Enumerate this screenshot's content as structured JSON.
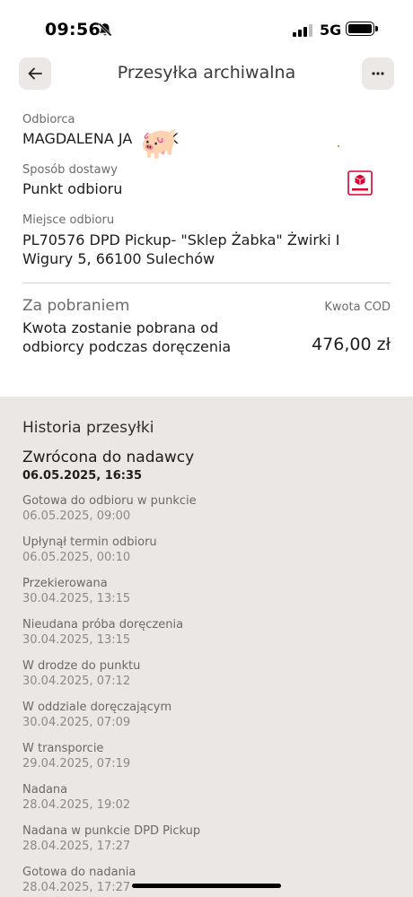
{
  "status_bar": {
    "time": "09:56",
    "network": "5G",
    "icons": [
      "bell-slash-icon",
      "signal-icon",
      "battery-icon"
    ]
  },
  "header": {
    "title": "Przesyłka archiwalna",
    "back_icon": "arrow-left-icon",
    "more_icon": "ellipsis-icon"
  },
  "recipient": {
    "label": "Odbiorca",
    "value": "MAGDALENA JA      EK"
  },
  "delivery": {
    "label": "Sposób dostawy",
    "value": "Punkt odbioru",
    "icon": "parcel-box-icon"
  },
  "pickup_place": {
    "label": "Miejsce odbioru",
    "value": "PL70576 DPD Pickup- \"Sklep Żabka\"  Żwirki I Wigury 5, 66100 Sulechów"
  },
  "cod": {
    "title": "Za pobraniem",
    "amount_label": "Kwota COD",
    "description": "Kwota zostanie pobrana od odbiorcy podczas doręczenia",
    "amount": "476,00 zł"
  },
  "history": {
    "title": "Historia przesyłki",
    "current_status": "Zwrócona do nadawcy",
    "current_date": "06.05.2025, 16:35",
    "events": [
      {
        "status": "Gotowa do odbioru w punkcie",
        "date": "06.05.2025, 09:00"
      },
      {
        "status": "Upłynął termin odbioru",
        "date": "06.05.2025, 00:10"
      },
      {
        "status": "Przekierowana",
        "date": "30.04.2025, 13:15"
      },
      {
        "status": "Nieudana próba doręczenia",
        "date": "30.04.2025, 13:15"
      },
      {
        "status": "W drodze do punktu",
        "date": "30.04.2025, 07:12"
      },
      {
        "status": "W oddziale doręczającym",
        "date": "30.04.2025, 07:09"
      },
      {
        "status": "W transporcie",
        "date": "29.04.2025, 07:19"
      },
      {
        "status": "Nadana",
        "date": "28.04.2025, 19:02"
      },
      {
        "status": "Nadana w punkcie DPD Pickup",
        "date": "28.04.2025, 17:27"
      },
      {
        "status": "Gotowa do nadania",
        "date": "28.04.2025, 17:27"
      }
    ]
  },
  "colors": {
    "accent": "#dc0032",
    "history_bg": "#ebe7e4"
  }
}
